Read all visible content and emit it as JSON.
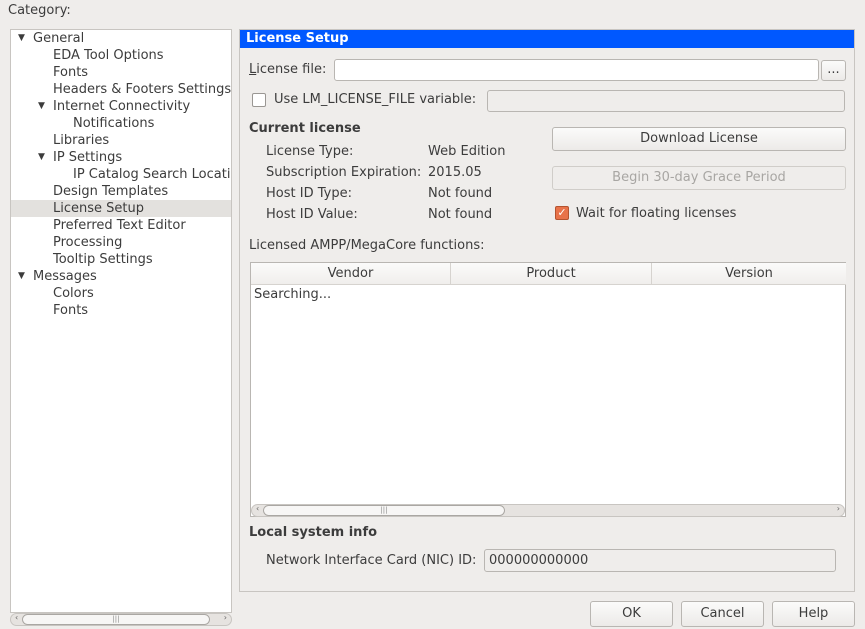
{
  "category_label": "Category:",
  "tree": [
    {
      "label": "General",
      "level": 0,
      "expanded": true
    },
    {
      "label": "EDA Tool Options",
      "level": 1
    },
    {
      "label": "Fonts",
      "level": 1
    },
    {
      "label": "Headers & Footers Settings",
      "level": 1
    },
    {
      "label": "Internet Connectivity",
      "level": 1,
      "expanded": true
    },
    {
      "label": "Notifications",
      "level": 2
    },
    {
      "label": "Libraries",
      "level": 1
    },
    {
      "label": "IP Settings",
      "level": 1,
      "expanded": true
    },
    {
      "label": "IP Catalog Search Locations",
      "level": 2
    },
    {
      "label": "Design Templates",
      "level": 1
    },
    {
      "label": "License Setup",
      "level": 1,
      "selected": true
    },
    {
      "label": "Preferred Text Editor",
      "level": 1
    },
    {
      "label": "Processing",
      "level": 1
    },
    {
      "label": "Tooltip Settings",
      "level": 1
    },
    {
      "label": "Messages",
      "level": 0,
      "expanded": true
    },
    {
      "label": "Colors",
      "level": 1
    },
    {
      "label": "Fonts",
      "level": 1
    }
  ],
  "panel": {
    "title": "License Setup",
    "license_file_label": "License file:",
    "license_file_value": "",
    "browse_label": "...",
    "use_lm_label": "Use LM_LICENSE_FILE variable:",
    "use_lm_checked": false,
    "lm_value": "",
    "current_license_heading": "Current license",
    "license_type_label": "License Type:",
    "license_type_value": "Web Edition",
    "subscription_label": "Subscription Expiration:",
    "subscription_value": "2015.05",
    "host_type_label": "Host ID Type:",
    "host_type_value": "Not found",
    "host_value_label": "Host ID Value:",
    "host_value_value": "Not found",
    "download_label": "Download License",
    "grace_label": "Begin 30-day Grace Period",
    "wait_label": "Wait for floating licenses",
    "wait_checked": true,
    "licensed_label": "Licensed AMPP/MegaCore functions:",
    "columns": [
      "Vendor",
      "Product",
      "Version"
    ],
    "status_text": "Searching...",
    "local_heading": "Local system info",
    "nic_label": "Network Interface Card (NIC) ID:",
    "nic_value": "000000000000"
  },
  "buttons": {
    "ok": "OK",
    "cancel": "Cancel",
    "help": "Help"
  },
  "colors": {
    "header": "#0058ff",
    "checkbox": "#e8734a"
  }
}
